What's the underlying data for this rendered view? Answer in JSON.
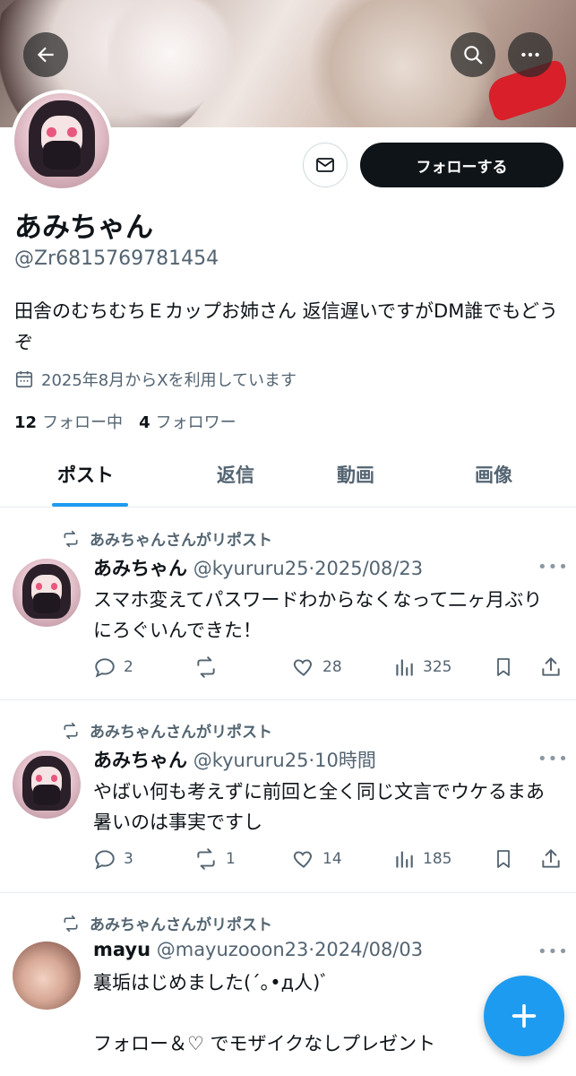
{
  "profile": {
    "name": "あみちゃん",
    "handle": "@Zr6815769781454",
    "bio": "田舎のむちむちＥカップお姉さん 返信遅いですがDM誰でもどうぞ",
    "joined": "2025年8月からXを利用しています",
    "following_count": "12",
    "following_label": "フォロー中",
    "followers_count": "4",
    "followers_label": "フォロワー",
    "follow_button": "フォローする"
  },
  "tabs": [
    {
      "label": "ポスト",
      "active": true
    },
    {
      "label": "返信",
      "active": false
    },
    {
      "label": "動画",
      "active": false
    },
    {
      "label": "画像",
      "active": false
    }
  ],
  "posts": [
    {
      "repost_label": "あみちゃんさんがリポスト",
      "name": "あみちゃん",
      "meta": "@kyururu25·2025/08/23",
      "text": "スマホ変えてパスワードわからなくなって二ヶ月ぶりにろぐいんできた！",
      "replies": "2",
      "reposts": "",
      "likes": "28",
      "views": "325"
    },
    {
      "repost_label": "あみちゃんさんがリポスト",
      "name": "あみちゃん",
      "meta": "@kyururu25·10時間",
      "text": "やばい何も考えずに前回と全く同じ文言でウケるまあ暑いのは事実ですし",
      "replies": "3",
      "reposts": "1",
      "likes": "14",
      "views": "185"
    },
    {
      "repost_label": "あみちゃんさんがリポスト",
      "name": "mayu",
      "meta": "@mayuzooon23·2024/08/03",
      "text": "裏垢はじめました(´｡•д人)ﾞ\n\nフォロー＆♡ でモザイクなしプレゼント",
      "replies": "",
      "reposts": "",
      "likes": "",
      "views": ""
    }
  ],
  "icons": {
    "back": "arrow-left-icon",
    "search": "search-icon",
    "more": "more-horizontal-icon",
    "mail": "mail-icon",
    "calendar": "calendar-icon",
    "repost": "repost-icon",
    "reply": "reply-icon",
    "like": "heart-icon",
    "views": "views-icon",
    "bookmark": "bookmark-icon",
    "share": "share-icon",
    "compose": "plus-icon"
  },
  "colors": {
    "accent": "#1d9bf0",
    "text": "#0f1419",
    "secondary": "#536471"
  }
}
